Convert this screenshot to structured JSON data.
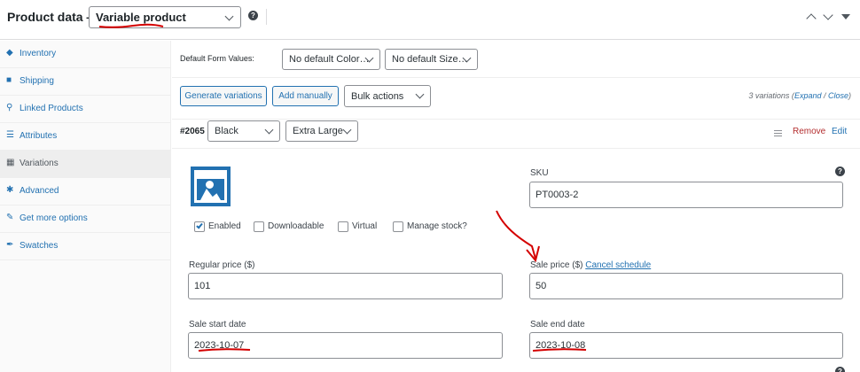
{
  "header": {
    "title": "Product data —",
    "product_type": "Variable product"
  },
  "sidebar": {
    "items": [
      {
        "label": "Inventory",
        "icon": "inventory-icon"
      },
      {
        "label": "Shipping",
        "icon": "truck-icon"
      },
      {
        "label": "Linked Products",
        "icon": "link-icon"
      },
      {
        "label": "Attributes",
        "icon": "list-icon"
      },
      {
        "label": "Variations",
        "icon": "grid-icon"
      },
      {
        "label": "Advanced",
        "icon": "gear-icon"
      },
      {
        "label": "Get more options",
        "icon": "plugin-icon"
      },
      {
        "label": "Swatches",
        "icon": "wrench-icon"
      }
    ]
  },
  "defaults": {
    "label": "Default Form Values:",
    "color": "No default Color…",
    "size": "No default Size…"
  },
  "toolbar": {
    "generate": "Generate variations",
    "add_manually": "Add manually",
    "bulk_actions": "Bulk actions",
    "count_text": "3 variations (",
    "expand": "Expand",
    "slash": " / ",
    "close": "Close",
    "paren": ")"
  },
  "variation": {
    "id": "#2065",
    "color": "Black",
    "size": "Extra Large",
    "remove": "Remove",
    "edit": "Edit",
    "sku_label": "SKU",
    "sku_value": "PT0003-2",
    "enabled": "Enabled",
    "downloadable": "Downloadable",
    "virtual": "Virtual",
    "manage_stock": "Manage stock?",
    "regular_price_label": "Regular price ($)",
    "regular_price": "101",
    "sale_price_label": "Sale price ($)",
    "cancel_schedule": "Cancel schedule",
    "sale_price": "50",
    "sale_start_label": "Sale start date",
    "sale_start": "2023-10-07",
    "sale_end_label": "Sale end date",
    "sale_end": "2023-10-08"
  },
  "colors": {
    "accent": "#2271b1",
    "annotation": "#d40000",
    "remove": "#b32d2e"
  }
}
